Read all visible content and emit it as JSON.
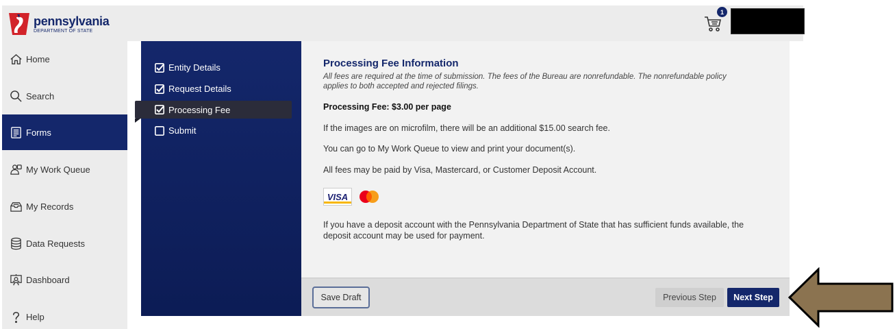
{
  "header": {
    "logo_title": "pennsylvania",
    "logo_subtitle": "DEPARTMENT OF STATE",
    "cart_count": "1"
  },
  "sidebar": {
    "items": [
      {
        "label": "Home",
        "icon": "home-icon"
      },
      {
        "label": "Search",
        "icon": "search-icon"
      },
      {
        "label": "Forms",
        "icon": "forms-icon",
        "active": true
      },
      {
        "label": "My Work Queue",
        "icon": "work-queue-icon"
      },
      {
        "label": "My Records",
        "icon": "records-icon"
      },
      {
        "label": "Data Requests",
        "icon": "database-icon"
      },
      {
        "label": "Dashboard",
        "icon": "dashboard-icon"
      },
      {
        "label": "Help",
        "icon": "help-icon"
      }
    ]
  },
  "steps": {
    "items": [
      {
        "label": "Entity Details",
        "checked": true
      },
      {
        "label": "Request Details",
        "checked": true
      },
      {
        "label": "Processing Fee",
        "checked": true,
        "current": true
      },
      {
        "label": "Submit",
        "checked": false
      }
    ]
  },
  "content": {
    "title": "Processing Fee Information",
    "note": "All fees are required at the time of submission. The fees of the Bureau are nonrefundable. The nonrefundable policy applies to both accepted and rejected filings.",
    "fee": "Processing Fee: $3.00 per page",
    "para1": "If the images are on microfilm, there will be an additional $15.00 search fee.",
    "para2": "You can go to My Work Queue to view and print your document(s).",
    "para3": "All fees may be paid by Visa, Mastercard, or Customer Deposit Account.",
    "visa_label": "VISA",
    "para4": "If you have a deposit account with the Pennsylvania Department of State that has sufficient funds available, the deposit account may be used for payment."
  },
  "footer": {
    "save_draft": "Save Draft",
    "previous": "Previous Step",
    "next": "Next Step"
  },
  "colors": {
    "brand": "#14276b",
    "accent_red": "#d2232a",
    "arrow": "#8b7350"
  }
}
